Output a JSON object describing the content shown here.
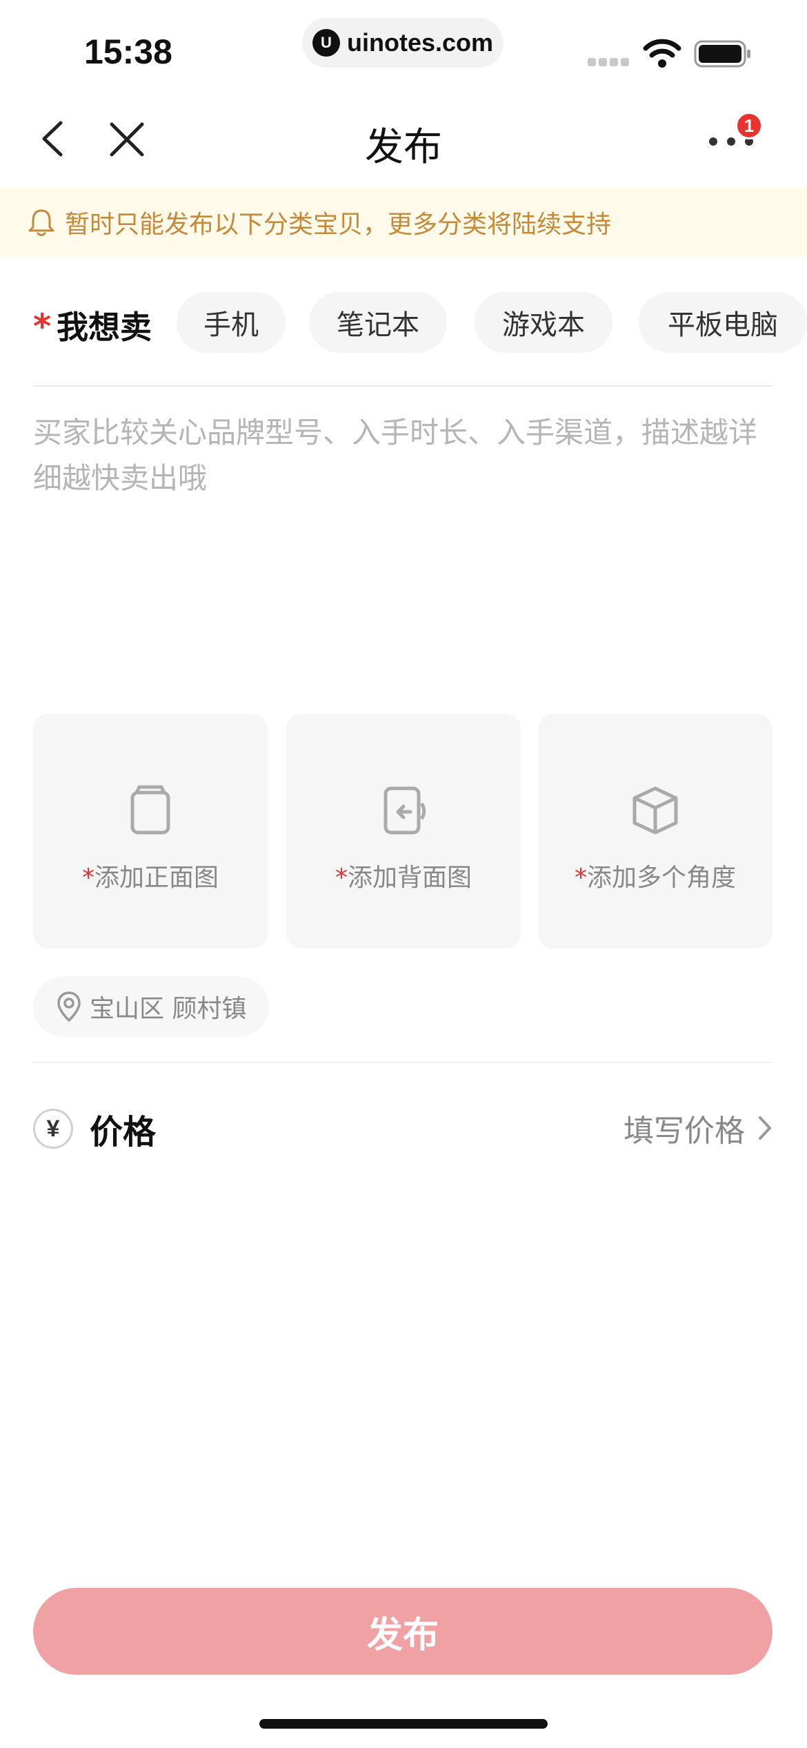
{
  "status_bar": {
    "time": "15:38",
    "url_logo": "U",
    "url": "uinotes.com"
  },
  "nav": {
    "title": "发布",
    "badge_count": "1"
  },
  "notice": {
    "text": "暂时只能发布以下分类宝贝，更多分类将陆续支持"
  },
  "category": {
    "required_mark": "*",
    "label": "我想卖",
    "chips": [
      "手机",
      "笔记本",
      "游戏本",
      "平板电脑"
    ]
  },
  "description": {
    "placeholder": "买家比较关心品牌型号、入手时长、入手渠道，描述越详细越快卖出哦"
  },
  "photos": {
    "required_mark": "*",
    "tiles": [
      {
        "label": "添加正面图",
        "icon": "phone-front-icon"
      },
      {
        "label": "添加背面图",
        "icon": "phone-back-rotate-icon"
      },
      {
        "label": "添加多个角度",
        "icon": "cube-icon"
      }
    ]
  },
  "location": {
    "text": "宝山区 顾村镇",
    "icon": "location-pin-icon"
  },
  "price": {
    "icon_glyph": "¥",
    "label": "价格",
    "action": "填写价格"
  },
  "publish_button": {
    "label": "发布"
  },
  "colors": {
    "accent_red": "#e8332e",
    "publish_button": "#f0a1a4",
    "notice_bg": "#fffaea",
    "notice_text": "#c48a3a"
  }
}
